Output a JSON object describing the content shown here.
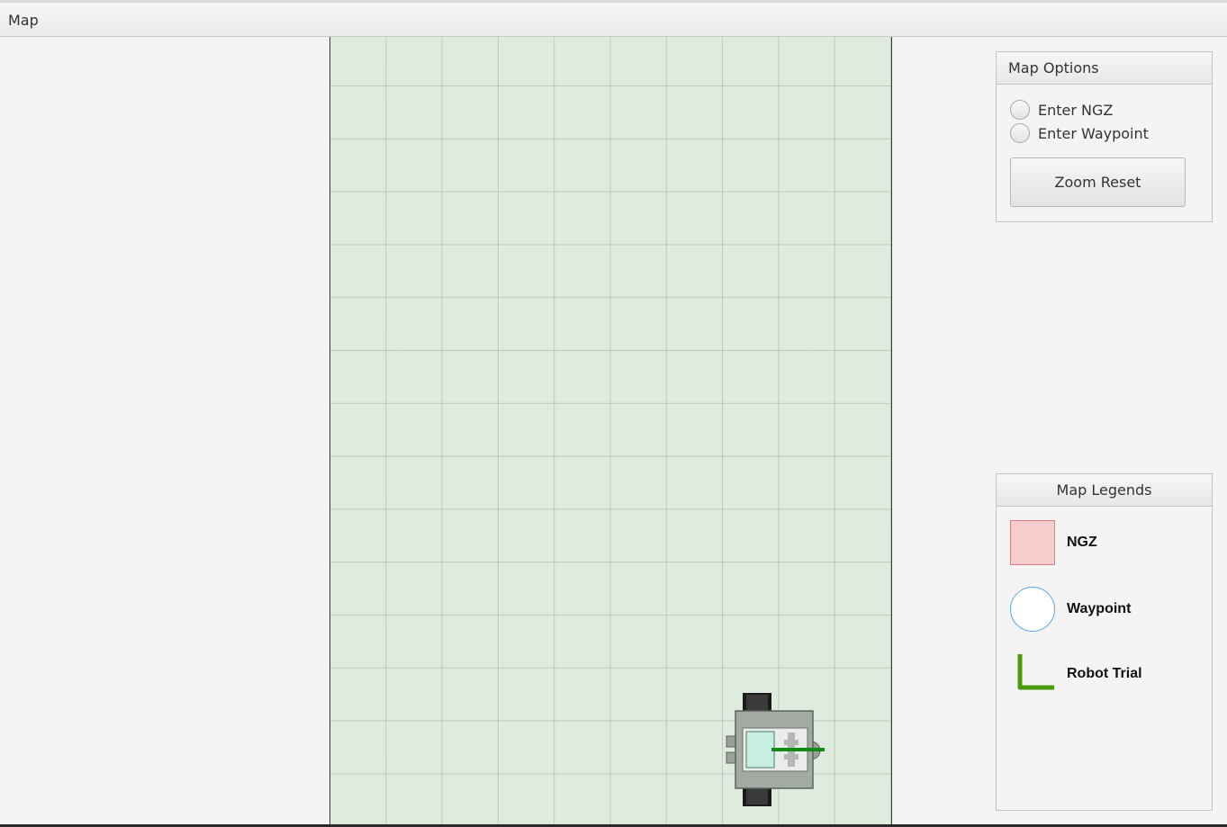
{
  "window": {
    "title": "Map"
  },
  "map_options": {
    "title": "Map Options",
    "radio_ngz": "Enter NGZ",
    "radio_waypoint": "Enter Waypoint",
    "zoom_reset": "Zoom Reset"
  },
  "map_legends": {
    "title": "Map Legends",
    "ngz": "NGZ",
    "waypoint": "Waypoint",
    "robot_trial": "Robot Trial"
  },
  "colors": {
    "map_background": "#dfebdf",
    "grid_line": "#9bb79f",
    "ngz_fill": "#f7cccc",
    "ngz_border": "#d98080",
    "waypoint_border": "#5aa6e6",
    "robot_trial": "#4a9a0a",
    "robot_heading": "#138a13"
  },
  "icons": {
    "robot": "robot-icon",
    "ngz": "ngz-swatch-icon",
    "waypoint": "waypoint-circle-icon",
    "robot_trial": "l-path-icon"
  }
}
